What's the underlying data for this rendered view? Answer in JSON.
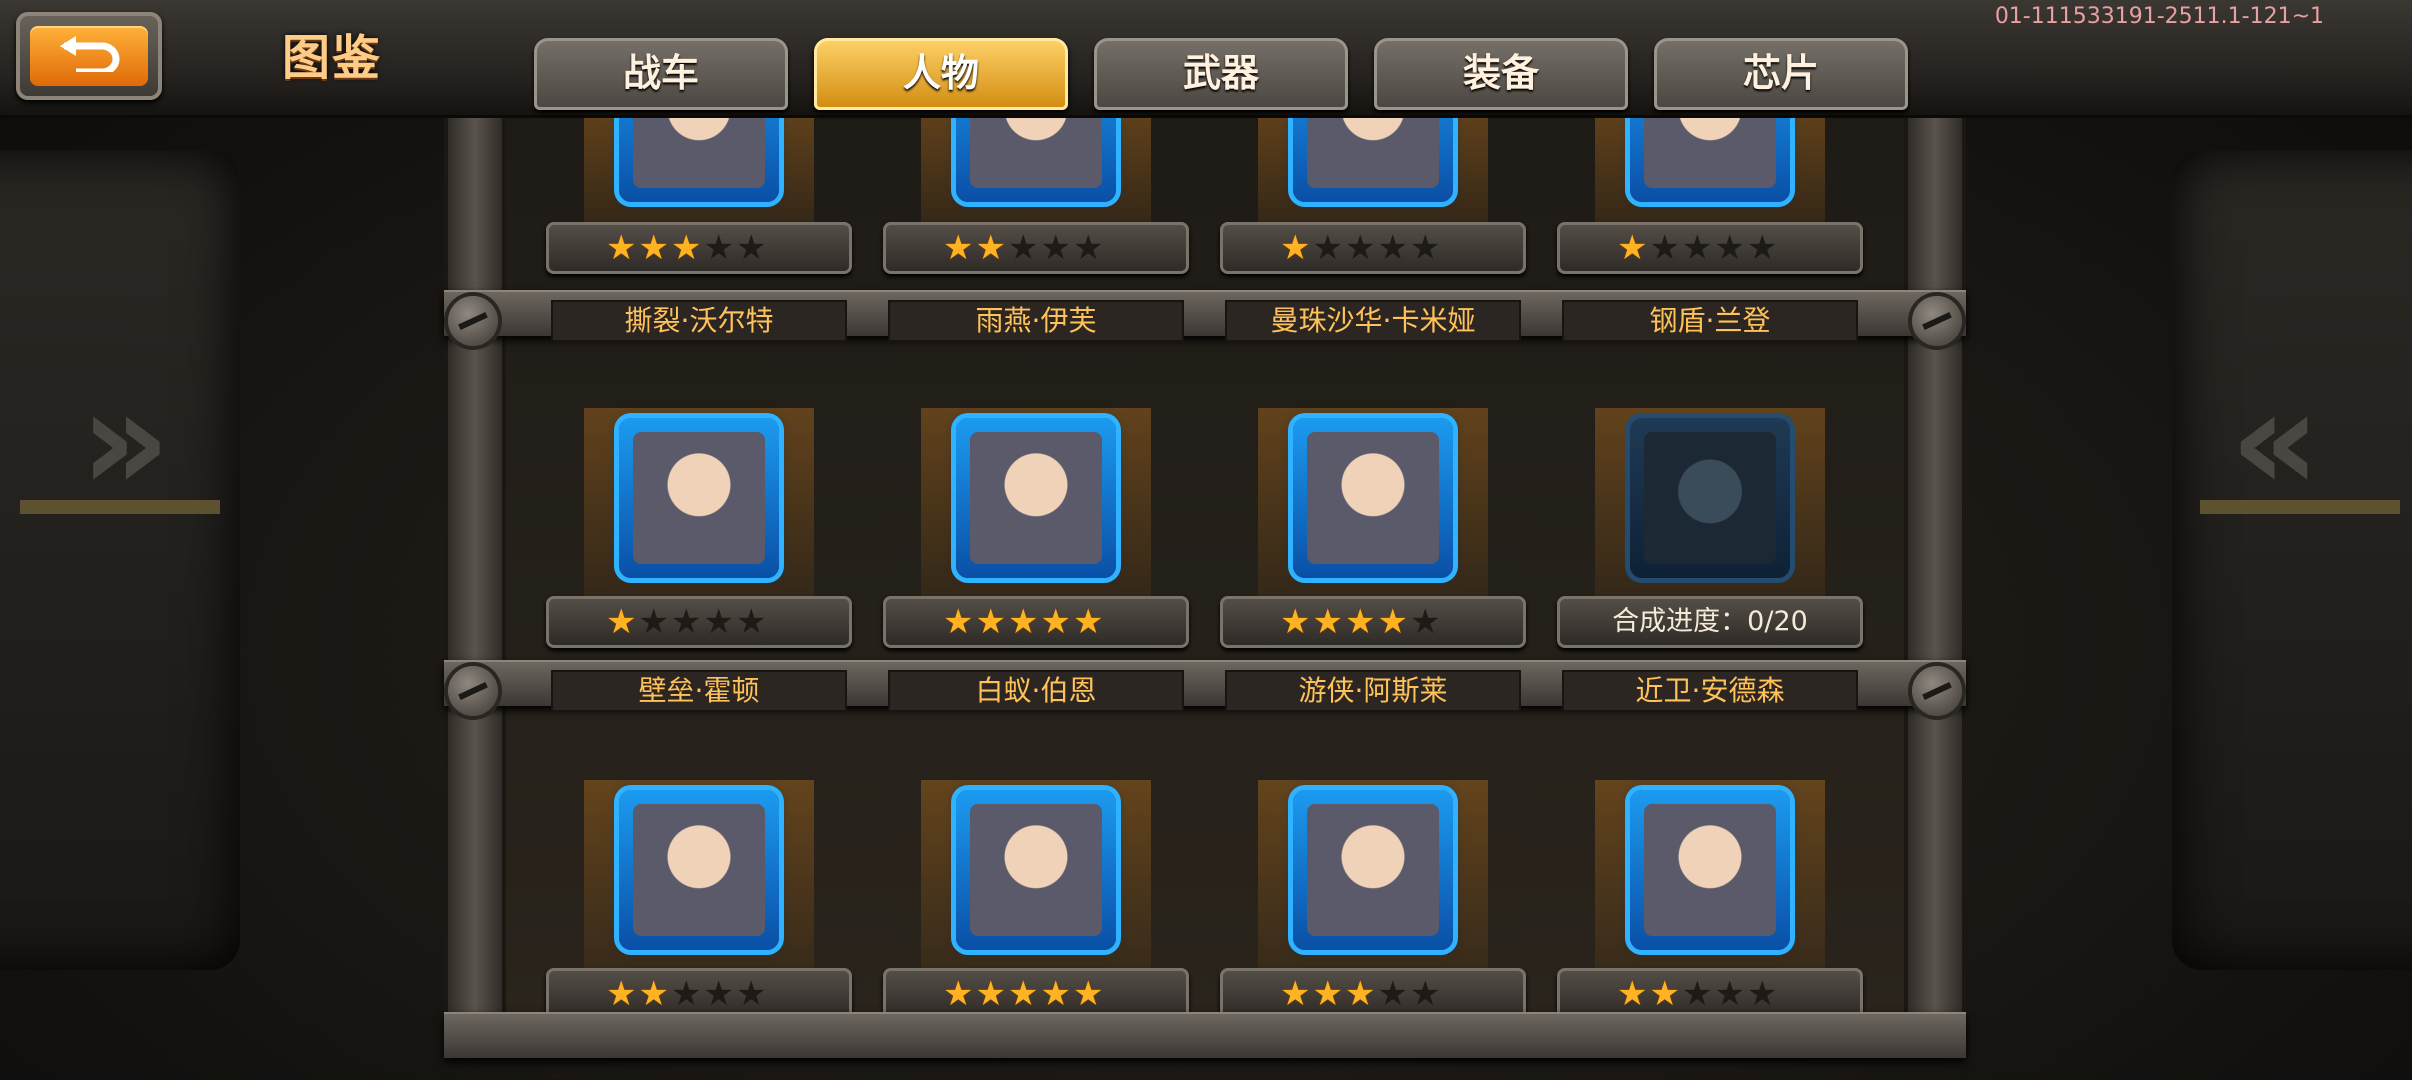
{
  "header": {
    "back_icon": "return-arrow-icon",
    "title": "图鉴",
    "build_info": "01-111533191-2511.1-121~1"
  },
  "tabs": [
    {
      "label": "战车",
      "active": false
    },
    {
      "label": "人物",
      "active": true
    },
    {
      "label": "武器",
      "active": false
    },
    {
      "label": "装备",
      "active": false
    },
    {
      "label": "芯片",
      "active": false
    }
  ],
  "rows": [
    {
      "characters": [
        {
          "name": "撕裂·沃尔特",
          "stars": 3
        },
        {
          "name": "雨燕·伊芙",
          "stars": 2
        },
        {
          "name": "曼珠沙华·卡米娅",
          "stars": 1
        },
        {
          "name": "钢盾·兰登",
          "stars": 1
        }
      ]
    },
    {
      "characters": [
        {
          "name": "壁垒·霍顿",
          "stars": 1
        },
        {
          "name": "白蚁·伯恩",
          "stars": 5
        },
        {
          "name": "游侠·阿斯莱",
          "stars": 4
        },
        {
          "name": "近卫·安德森",
          "locked": true,
          "progress_label": "合成进度：0/20"
        }
      ]
    },
    {
      "characters": [
        {
          "stars": 2
        },
        {
          "stars": 5
        },
        {
          "stars": 3
        },
        {
          "stars": 2
        }
      ]
    }
  ],
  "max_stars": 5,
  "colors": {
    "accent": "#ffb322",
    "tab_active": "#e8a21c",
    "portrait_border": "#2fb2ff",
    "name_text": "#ffc15a"
  }
}
